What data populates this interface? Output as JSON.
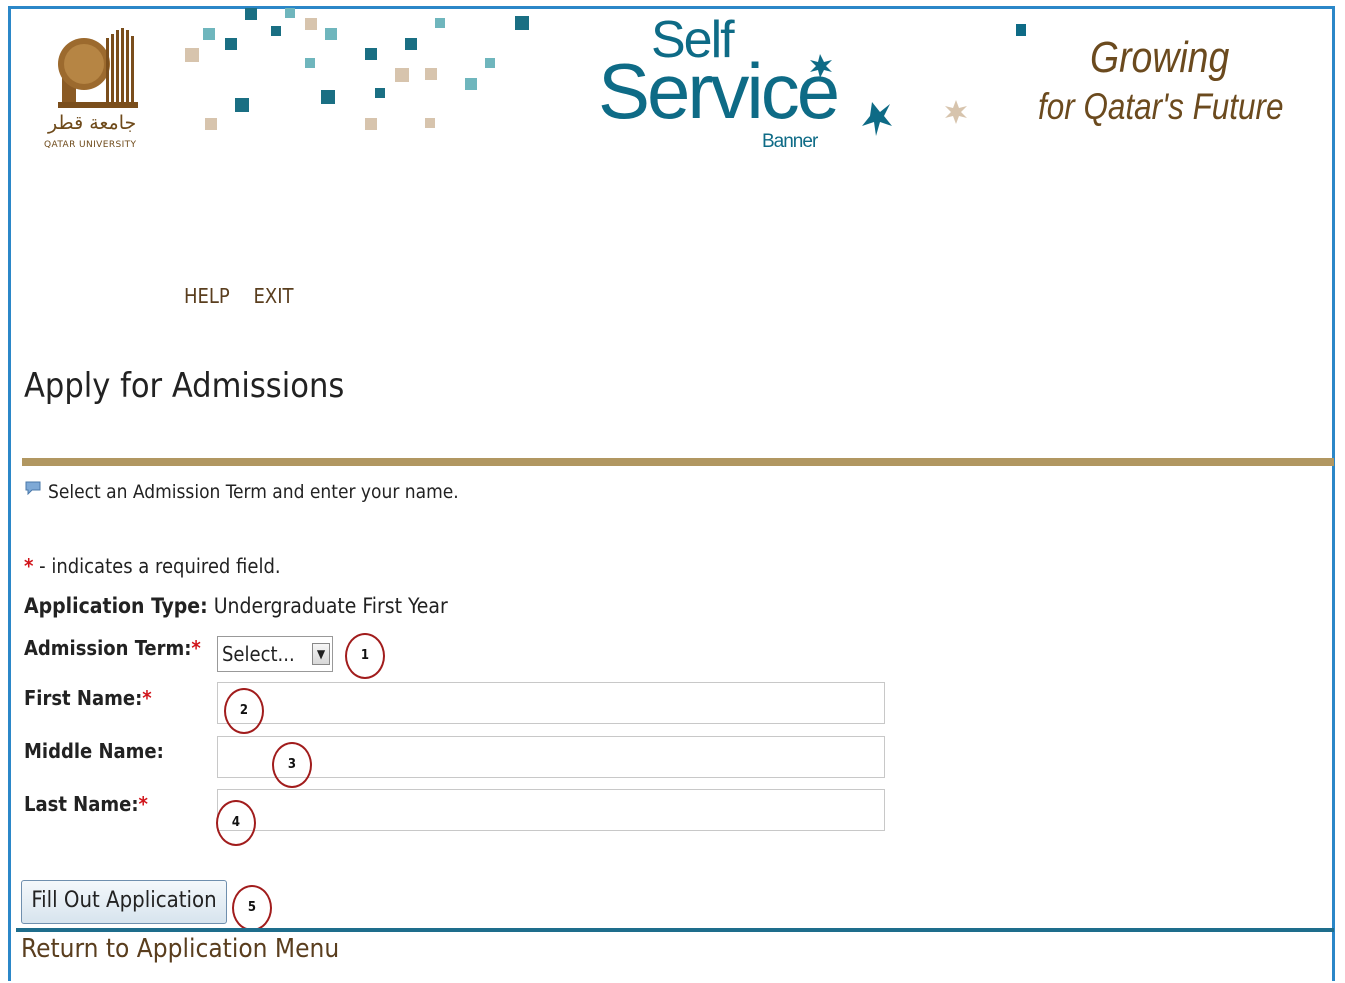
{
  "header": {
    "logo_arabic": "جامعة قطر",
    "logo_english": "QATAR UNIVERSITY",
    "self_service": {
      "self": "Self",
      "service": "Service",
      "banner": "Banner"
    },
    "tagline": {
      "line1": "Growing",
      "line2": "for Qatar's Future"
    },
    "colors": {
      "teal": "#0e6b86",
      "brown": "#6b4a1e",
      "frame": "#2b87c8"
    }
  },
  "nav": {
    "help": "HELP",
    "exit": "EXIT"
  },
  "page": {
    "title": "Apply for Admissions",
    "info_text": "Select an Admission Term and enter your name.",
    "required_star": "*",
    "required_note": " - indicates a required field."
  },
  "form": {
    "application_type": {
      "label": "Application Type:",
      "value": "Undergraduate First Year"
    },
    "admission_term": {
      "label": "Admission Term:",
      "value": "Select...",
      "arrow": "▼"
    },
    "first_name": {
      "label": "First Name:",
      "value": ""
    },
    "middle_name": {
      "label": "Middle Name:",
      "value": ""
    },
    "last_name": {
      "label": "Last Name:",
      "value": ""
    },
    "submit_label": "Fill Out Application"
  },
  "badges": [
    "1",
    "2",
    "3",
    "4",
    "5"
  ],
  "footer": {
    "return_link": "Return to Application Menu"
  }
}
